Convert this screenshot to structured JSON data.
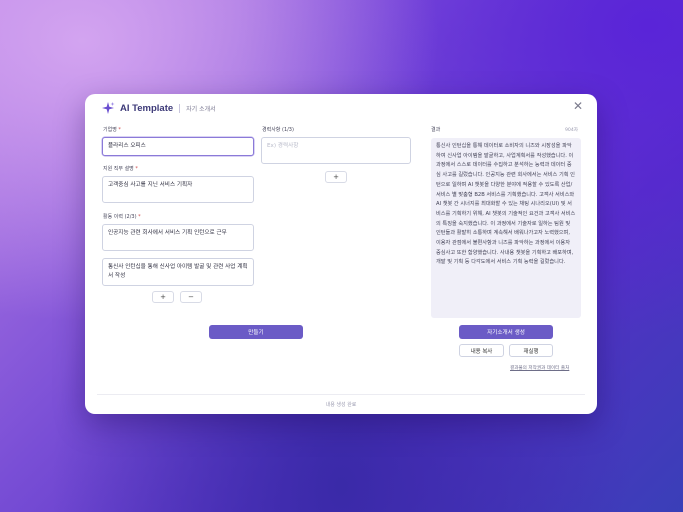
{
  "header": {
    "app_title": "AI Template",
    "subtitle": "자기 소개서",
    "close_glyph": "✕",
    "logo_icon": "sparkle-icon",
    "accent_color": "#6b5bc6"
  },
  "form": {
    "company": {
      "label": "기업명",
      "required": "*",
      "value": "플라리스 오피스"
    },
    "job_desc": {
      "label": "지원 직무 설명",
      "required": "*",
      "value": "고객중심 사고를 지닌 서비스 기획자"
    },
    "activities": {
      "label": "활동 이력 (2/3)",
      "required": "*",
      "items": [
        "인공지능 관련 회사에서 서비스 기획 인턴으로 근무",
        "통신사 인턴십을 통해 신사업 아이템 발굴 및 관련 사업 계획서 작성"
      ],
      "add_glyph": "+",
      "remove_glyph": "−"
    },
    "experience": {
      "label": "경력사항 (1/3)",
      "placeholder": "Ex) 경력사항",
      "add_glyph": "+"
    },
    "generate_button": "만들기"
  },
  "result": {
    "label": "결과",
    "counter": "904자",
    "text": "통신사 인턴십을 통해 데이터로 소비자의 니즈와 시장성을 파악하여 신사업 아이템을 발굴하고, 사업계획서를 작성했습니다. 이 과정에서 스스로 데이터를 수집하고 분석하는 능력과 데이터 중심 사고를 길렀습니다. 인공지능 관련 회사에서는 서비스 기획 인턴으로 일하며 AI 챗봇을 다양한 분야에 적용할 수 있도록 산업/서비스 별 맞춤형 B2B 서비스를 기획했습니다. 고객사 서비스와 AI 챗봇 간 시너지를 최대화할 수 있는 채팅 시나리오(UI) 및 서비스를 기획하기 위해, AI 챗봇의 기술적인 요건과 고객사 서비스의 특징을 숙지했습니다. 이 과정에서 기술자로 일하는 팀원 및 인턴들과 활발히 소통하며 계속해서 배워나가고자 노력했으며, 이용자 관점에서 불편사항과 니즈를 파악하는 과정에서 이용자 중심사고 또한 함양했습니다. 사내용 챗봇을 기획하고 배포하며, 개발 및 기획 등 다각도에서 서비스 기획 능력을 길렀습니다.",
    "generate_button": "자기소개서 생성",
    "copy_button": "내용 복사",
    "regenerate_button": "재실행",
    "link_text": "결과물의 저작권과 데이터 출처"
  },
  "footer": {
    "status": "내용 생성 완료"
  }
}
